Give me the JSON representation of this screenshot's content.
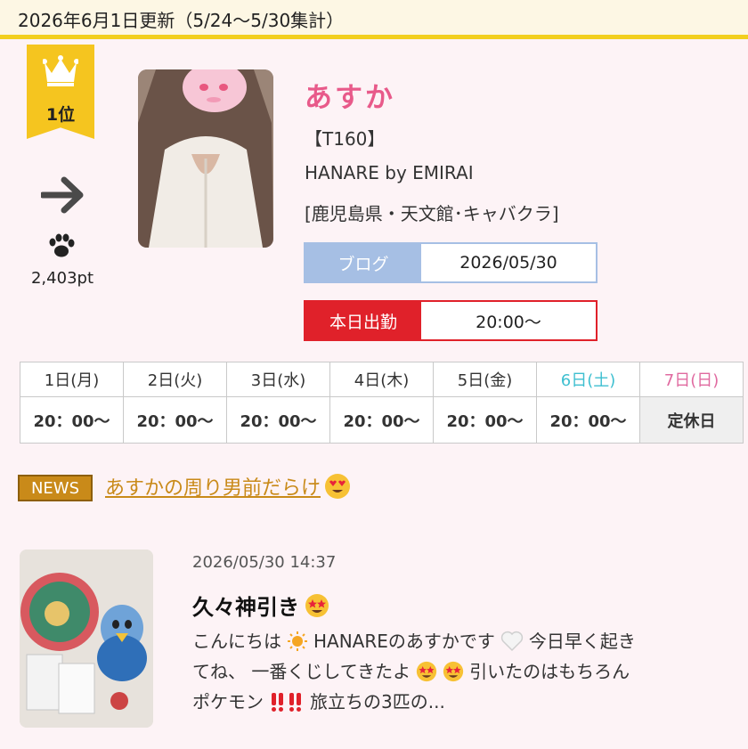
{
  "header": {
    "update_text": "2026年6月1日更新（5/24〜5/30集計）"
  },
  "rank": {
    "label": "1位",
    "trend_icon": "arrow-right-icon",
    "points_icon": "paw-icon",
    "points": "2,403pt"
  },
  "profile": {
    "name": "あすか",
    "height": "【T160】",
    "shop": "HANARE by EMIRAI",
    "area": "[鹿児島県・天文館･キャバクラ]"
  },
  "blog": {
    "label": "ブログ",
    "date": "2026/05/30"
  },
  "attendance": {
    "label": "本日出勤",
    "time": "20:00〜"
  },
  "schedule": {
    "days": [
      "1日(月)",
      "2日(火)",
      "3日(水)",
      "4日(木)",
      "5日(金)",
      "6日(土)",
      "7日(日)"
    ],
    "times": [
      "20：00〜",
      "20：00〜",
      "20：00〜",
      "20：00〜",
      "20：00〜",
      "20：00〜",
      "定休日"
    ]
  },
  "news": {
    "badge": "NEWS",
    "text": "あすかの周り男前だらけ"
  },
  "post": {
    "datetime": "2026/05/30 14:37",
    "title": "久々神引き",
    "line1_a": "こんにちは",
    "line1_b": "HANAREのあすかです",
    "line1_c": "今日早く起き",
    "line2_a": "てね、 一番くじしてきたよ",
    "line2_b": "引いたのはもちろん",
    "line3_a": "ポケモン",
    "line3_b": "旅立ちの3匹の..."
  },
  "colors": {
    "accent_pink": "#e85a8a",
    "gold": "#f5c51f",
    "blog_blue": "#a6bfe4",
    "work_red": "#e0212a",
    "saturday": "#3ebfd0",
    "sunday": "#e06aa0",
    "news_gold": "#c98a19"
  }
}
